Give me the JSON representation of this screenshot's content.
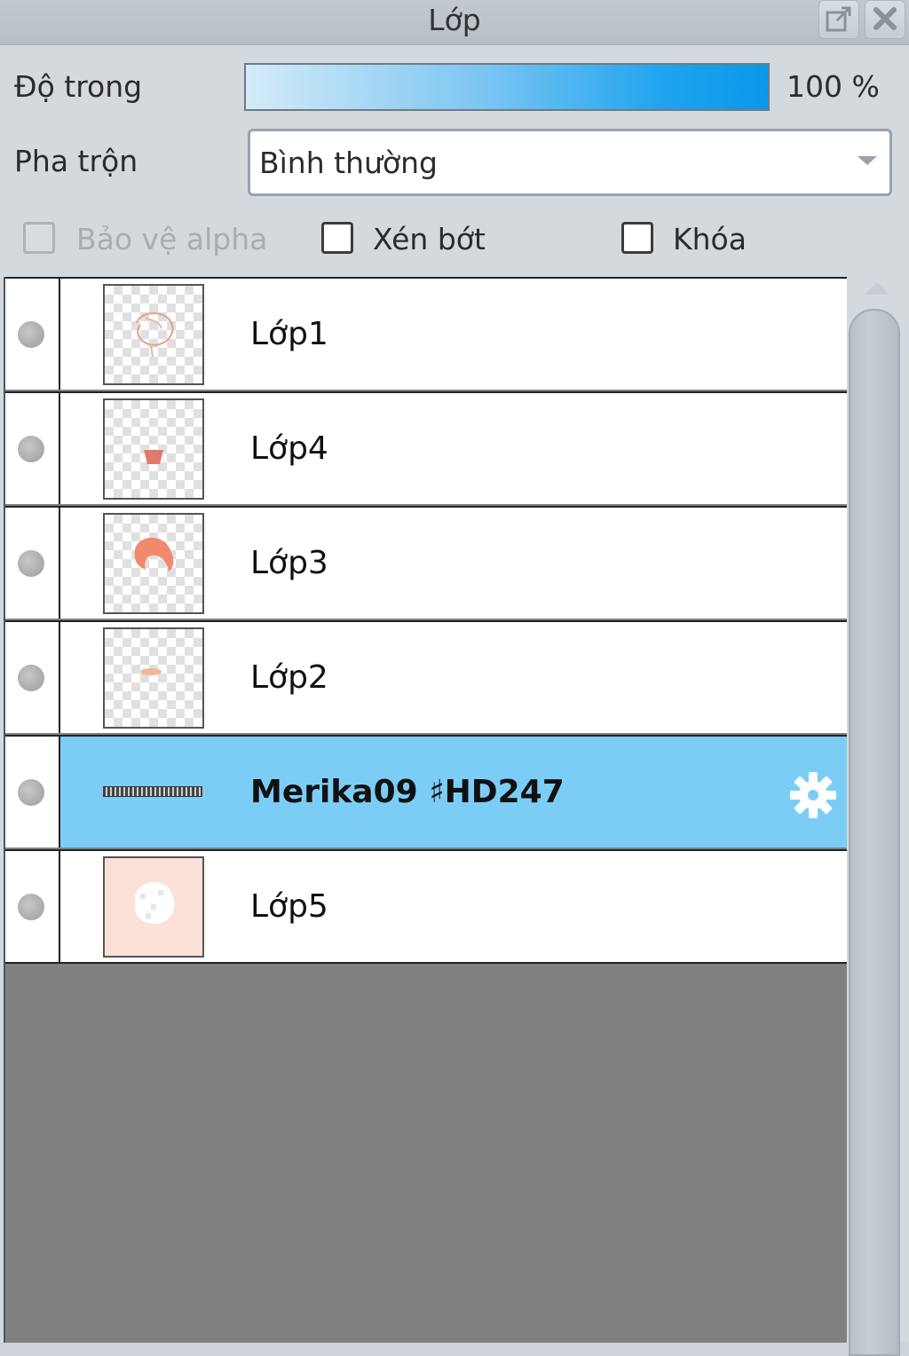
{
  "window": {
    "title": "Lớp",
    "popout_icon": "popout-icon",
    "close_icon": "close-icon"
  },
  "opacity": {
    "label": "Độ trong",
    "value_text": "100 %",
    "value": 1.0
  },
  "blend": {
    "label": "Pha trộn",
    "selected": "Bình thường"
  },
  "checkboxes": {
    "protect_alpha": {
      "label": "Bảo vệ alpha",
      "checked": false,
      "disabled": true
    },
    "clipping": {
      "label": "Xén bớt",
      "checked": false,
      "disabled": false
    },
    "lock": {
      "label": "Khóa",
      "checked": false,
      "disabled": false
    }
  },
  "layers": [
    {
      "name": "Lớp1",
      "selected": false,
      "thumb": "sketch"
    },
    {
      "name": "Lớp4",
      "selected": false,
      "thumb": "small-red"
    },
    {
      "name": "Lớp3",
      "selected": false,
      "thumb": "hair"
    },
    {
      "name": "Lớp2",
      "selected": false,
      "thumb": "mouth"
    },
    {
      "name": "Merika09 ♯HD247",
      "selected": true,
      "thumb": "folder",
      "icon": "gear-icon"
    },
    {
      "name": "Lớp5",
      "selected": false,
      "thumb": "skin"
    }
  ],
  "colors": {
    "selected_row": "#7ccdf5",
    "list_background": "#808080",
    "panel_background": "#d4d9de"
  }
}
